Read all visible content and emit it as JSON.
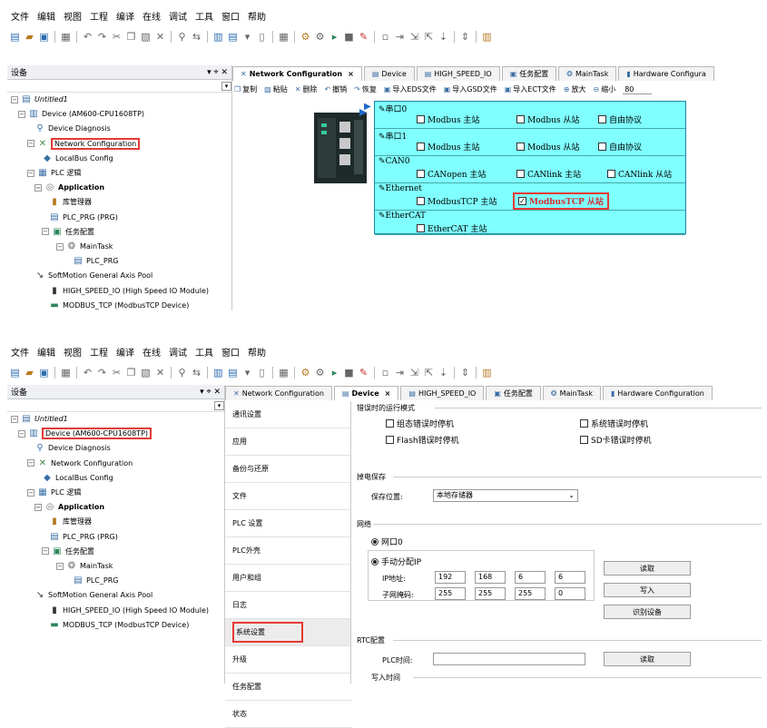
{
  "menu": [
    "文件",
    "编辑",
    "视图",
    "工程",
    "编译",
    "在线",
    "调试",
    "工具",
    "窗口",
    "帮助"
  ],
  "panel": {
    "title": "设备",
    "pin": "▾ ⌖ ✕"
  },
  "tree": {
    "project": "Untitled1",
    "device": "Device (AM600-CPU1608TP)",
    "diagnosis": "Device Diagnosis",
    "netconfig": "Network Configuration",
    "localbus": "LocalBus Config",
    "plclogic": "PLC 逻辑",
    "application": "Application",
    "library": "库管理器",
    "plcprg": "PLC_PRG (PRG)",
    "taskconfig": "任务配置",
    "maintask": "MainTask",
    "plcprg2": "PLC_PRG",
    "softmotion": "SoftMotion General Axis Pool",
    "highspeed": "HIGH_SPEED_IO (High Speed IO Module)",
    "modbustcp": "MODBUS_TCP (ModbusTCP Device)"
  },
  "tabs1": [
    "Network Configuration",
    "Device",
    "HIGH_SPEED_IO",
    "任务配置",
    "MainTask",
    "Hardware Configura"
  ],
  "tabs2": [
    "Network Configuration",
    "Device",
    "HIGH_SPEED_IO",
    "任务配置",
    "MainTask",
    "Hardware Configuration"
  ],
  "subtool": [
    "复制",
    "粘贴",
    "删除",
    "撤销",
    "恢复",
    "导入EDS文件",
    "导入GSD文件",
    "导入ECT文件",
    "放大",
    "缩小",
    "80"
  ],
  "net": {
    "rows": [
      {
        "port": "串口0",
        "opts": [
          "Modbus 主站",
          "Modbus 从站",
          "自由协议"
        ]
      },
      {
        "port": "串口1",
        "opts": [
          "Modbus 主站",
          "Modbus 从站",
          "自由协议"
        ]
      },
      {
        "port": "CAN0",
        "opts": [
          "CANopen 主站",
          "CANlink 主站",
          "CANlink 从站"
        ]
      },
      {
        "port": "Ethernet",
        "opts": [
          "ModbusTCP 主站",
          "ModbusTCP 从站"
        ]
      },
      {
        "port": "EtherCAT",
        "opts": [
          "EtherCAT 主站"
        ]
      }
    ],
    "checked_label": "ModbusTCP 从站"
  },
  "nav": [
    "通讯设置",
    "应用",
    "备份与还原",
    "文件",
    "PLC 设置",
    "PLC外壳",
    "用户和组",
    "日志",
    "系统设置",
    "升级",
    "任务配置",
    "状态"
  ],
  "cfg": {
    "err_title": "错误时的运行模式",
    "err_opts": [
      "组态错误时停机",
      "系统错误时停机",
      "Flash错误时停机",
      "SD卡错误时停机"
    ],
    "power_title": "掉电保存",
    "store_label": "保存位置:",
    "store_value": "本地存储器",
    "net_title": "网络",
    "port": "网口0",
    "manual": "手动分配IP",
    "ip_label": "IP地址:",
    "ip": [
      "192",
      "168",
      "6",
      "6"
    ],
    "mask_label": "子网掩码:",
    "mask": [
      "255",
      "255",
      "255",
      "0"
    ],
    "read": "读取",
    "write": "写入",
    "identify": "识别设备",
    "rtc_title": "RTC配置",
    "plc_time": "PLC时间:",
    "rtc_read": "读取",
    "write_time": "写入时间"
  },
  "colors": {
    "highlight": "#e53935",
    "net_bg": "#7fffff"
  }
}
